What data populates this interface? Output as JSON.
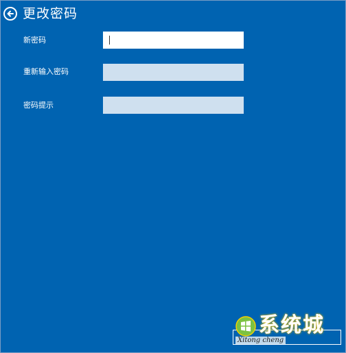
{
  "header": {
    "title": "更改密码",
    "back_icon": "back-arrow-circle-icon"
  },
  "form": {
    "fields": [
      {
        "label": "新密码",
        "value": "",
        "state": "focused"
      },
      {
        "label": "重新输入密码",
        "value": "",
        "state": "default"
      },
      {
        "label": "密码提示",
        "value": "",
        "state": "default"
      }
    ]
  },
  "watermark": {
    "text": "系统城",
    "subtext": "Xitong cheng",
    "logo_icon": "windows-logo-icon"
  },
  "colors": {
    "background": "#0063b1",
    "active_input": "#ffffff",
    "inactive_input": "#cfe0ef",
    "text": "#ffffff"
  }
}
